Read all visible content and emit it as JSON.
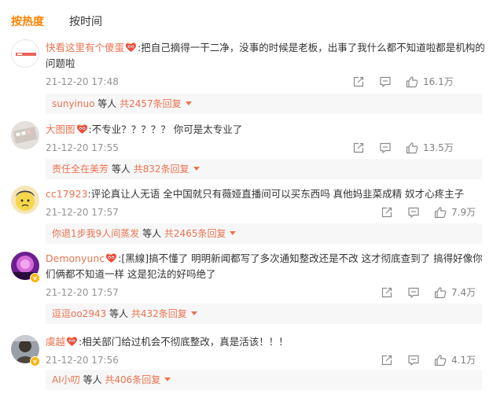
{
  "tabs": {
    "hot": "按热度",
    "time": "按时间"
  },
  "comments": [
    {
      "username": "快看这里有个傻蛋",
      "text": ":把自己摘得一干二净，没事的时候是老板，出事了我什么都不知道啦都是机构的问题啦",
      "time": "21-12-20 17:48",
      "likes": "16.1万",
      "reply": {
        "user": "sunyinuo",
        "mid": " 等人 ",
        "count": "共2457条回复"
      }
    },
    {
      "username": "大图图",
      "text": ":不专业？？？？？ 你可是太专业了",
      "time": "21-12-20 17:55",
      "likes": "13.5万",
      "reply": {
        "user": "责任全在美芳",
        "mid": " 等人 ",
        "count": "共832条回复"
      }
    },
    {
      "username": "cc17923",
      "text": ":评论真让人无语 全中国就只有薇娅直播间可以买东西吗 真他妈韭菜成精 奴才心疼主子",
      "time": "21-12-20 17:57",
      "likes": "7.9万",
      "reply": {
        "user": "你退1步我9人间蒸发",
        "mid": " 等人 ",
        "count": "共2465条回复"
      }
    },
    {
      "username": "Demonyunc",
      "text": ":[黑線]搞不懂了 明明新闻都写了多次通知整改还是不改 这才彻底查到了 搞得好像你们俩都不知道一样 这是犯法的好吗绝了",
      "time": "21-12-20 17:57",
      "likes": "7.4万",
      "reply": {
        "user": "逗逗oo2943",
        "mid": " 等人 ",
        "count": "共432条回复"
      }
    },
    {
      "username": "虞越",
      "text": ":相关部门给过机会不彻底整改，真是活该！！！",
      "time": "21-12-20 17:56",
      "likes": "4.1万",
      "reply": {
        "user": "AI小叨",
        "mid": " 等人 ",
        "count": "共406条回复"
      }
    }
  ]
}
